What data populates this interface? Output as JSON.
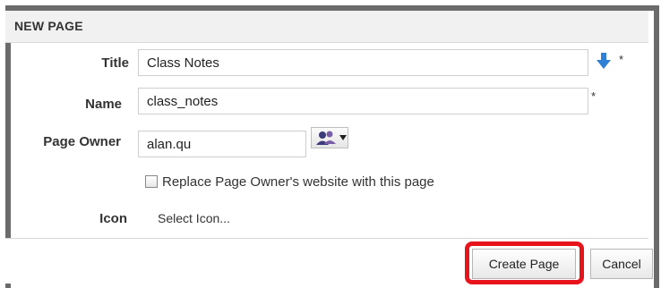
{
  "dialog": {
    "title": "NEW PAGE"
  },
  "form": {
    "title_label": "Title",
    "title_value": "Class Notes",
    "name_label": "Name",
    "name_value": "class_notes",
    "owner_label": "Page Owner",
    "owner_value": "alan.qu",
    "required_mark": "*",
    "replace_checkbox_label": "Replace Page Owner's website with this page",
    "replace_checked": false,
    "icon_label": "Icon",
    "icon_link": "Select Icon..."
  },
  "buttons": {
    "create": "Create Page",
    "cancel": "Cancel"
  },
  "colors": {
    "highlight": "#e8141b",
    "arrow": "#2f7fd6"
  }
}
